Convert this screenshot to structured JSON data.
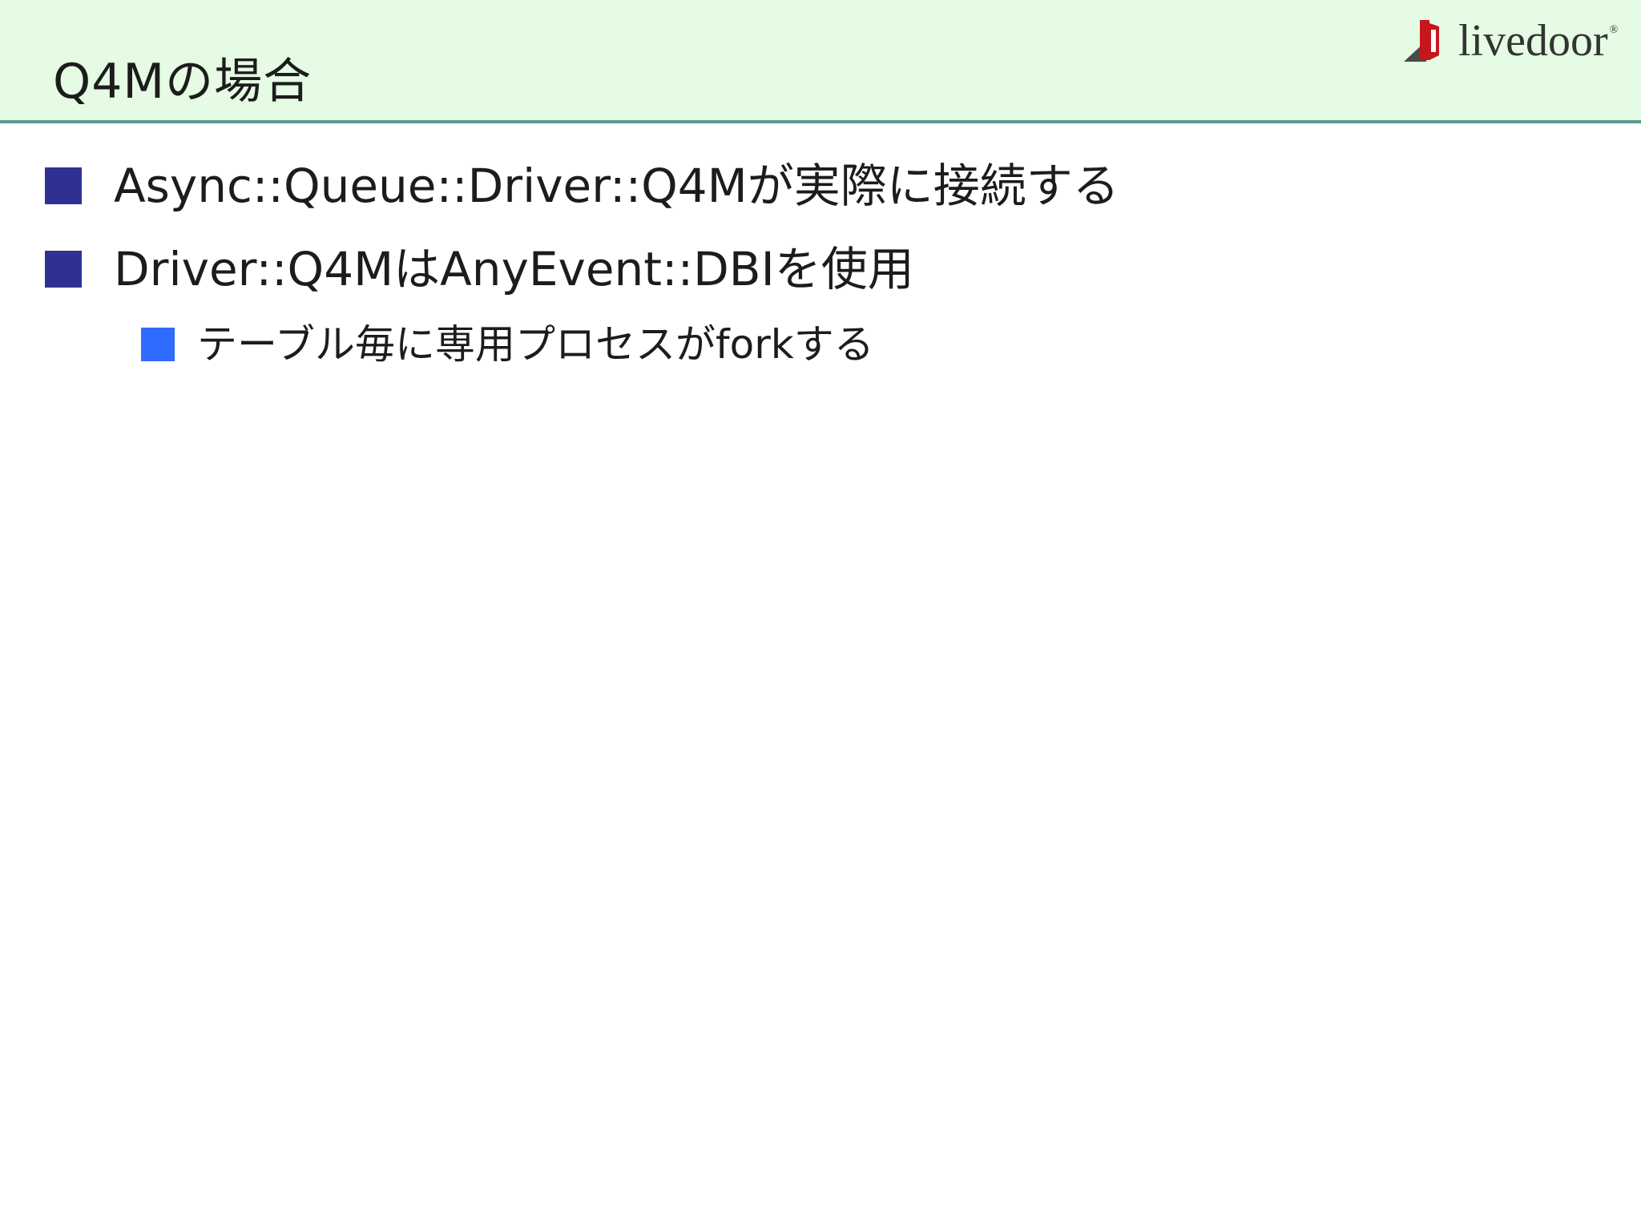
{
  "slide": {
    "title": "Q4Mの場合",
    "logo": {
      "text": "livedoor",
      "mark": "®"
    },
    "bullets": [
      {
        "level": 1,
        "text": "Async::Queue::Driver::Q4Mが実際に接続する"
      },
      {
        "level": 1,
        "text": "Driver::Q4MはAnyEvent::DBIを使用"
      },
      {
        "level": 2,
        "text": "テーブル毎に専用プロセスがforkする"
      }
    ]
  },
  "colors": {
    "header_bg": "#e6fbe3",
    "header_rule": "#5a9a92",
    "bullet_level1": "#2e3192",
    "bullet_level2": "#2f6bff",
    "logo_red": "#c8161d"
  }
}
